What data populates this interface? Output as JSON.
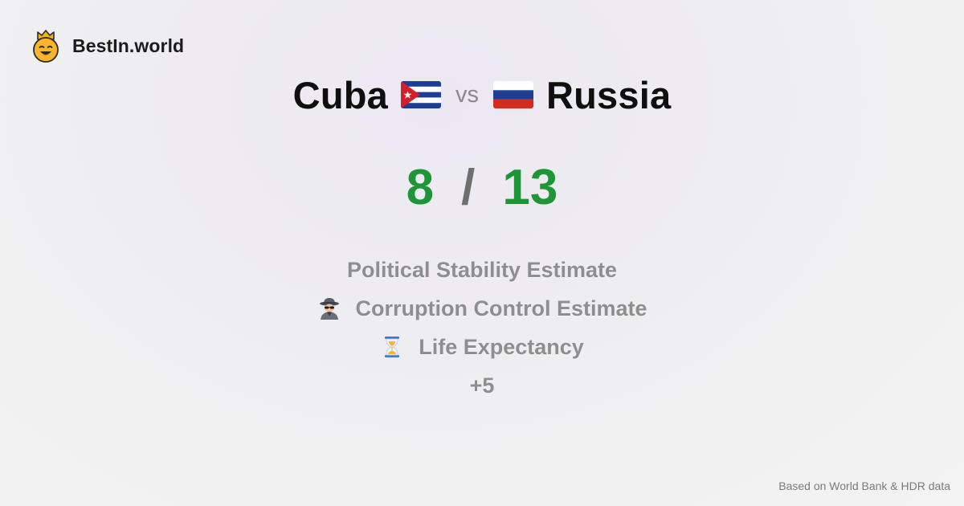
{
  "brand": {
    "name": "BestIn.world",
    "logo_icon": "crowned-smiley-icon"
  },
  "comparison": {
    "left_country": "Cuba",
    "left_flag_icon": "cuba-flag-icon",
    "vs_label": "vs",
    "right_country": "Russia",
    "right_flag_icon": "russia-flag-icon"
  },
  "score": {
    "left": "8",
    "separator": "/",
    "right": "13",
    "color": "#1e9638"
  },
  "criteria": [
    {
      "label": "Political Stability Estimate",
      "icon": ""
    },
    {
      "label": "Corruption Control Estimate",
      "icon": "detective-icon"
    },
    {
      "label": "Life Expectancy",
      "icon": "hourglass-icon"
    },
    {
      "label": "+5",
      "icon": ""
    }
  ],
  "footer": {
    "source_note": "Based on World Bank & HDR data"
  }
}
